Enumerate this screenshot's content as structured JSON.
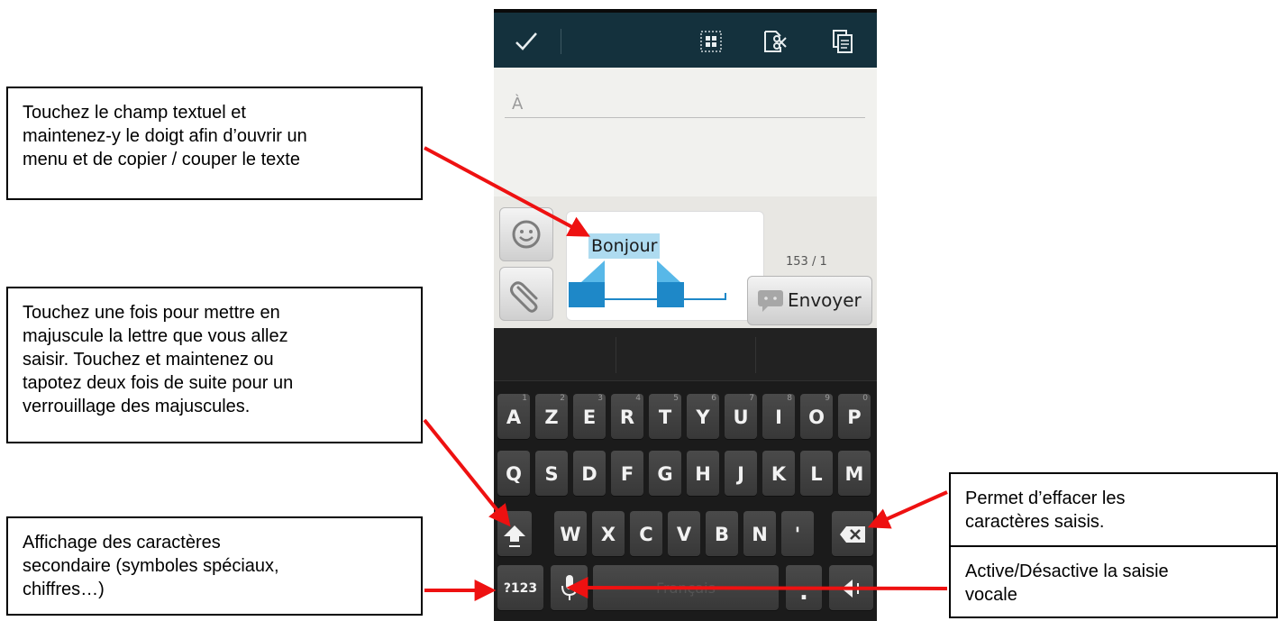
{
  "callouts": {
    "copy_cut": "Touchez le champ textuel et\nmaintenez-y le doigt afin d’ouvrir un\nmenu et de copier / couper le texte",
    "shift": "Touchez une fois pour mettre en\nmajuscule la lettre que vous allez\nsaisir. Touchez et maintenez ou\ntapotez deux fois de suite pour un\nverrouillage des majuscules.",
    "symbols": "Affichage des caractères\nsecondaire (symboles spéciaux,\nchiffres…)",
    "delete": "Permet d’effacer les\ncaractères saisis.",
    "voice": "Active/Désactive la saisie\nvocale"
  },
  "compose": {
    "to_placeholder": "À",
    "message_text": "Bonjour",
    "counter": "153 / 1",
    "send_label": "Envoyer"
  },
  "keyboard": {
    "row1": [
      {
        "key": "A",
        "hint": "1"
      },
      {
        "key": "Z",
        "hint": "2"
      },
      {
        "key": "E",
        "hint": "3"
      },
      {
        "key": "R",
        "hint": "4"
      },
      {
        "key": "T",
        "hint": "5"
      },
      {
        "key": "Y",
        "hint": "6"
      },
      {
        "key": "U",
        "hint": "7"
      },
      {
        "key": "I",
        "hint": "8"
      },
      {
        "key": "O",
        "hint": "9"
      },
      {
        "key": "P",
        "hint": "0"
      }
    ],
    "row2": [
      "Q",
      "S",
      "D",
      "F",
      "G",
      "H",
      "J",
      "K",
      "L",
      "M"
    ],
    "row3": [
      "W",
      "X",
      "C",
      "V",
      "B",
      "N",
      "'"
    ],
    "symbols_key": "?123",
    "space_label": "Français",
    "period_key": "."
  },
  "icons": {
    "actionbar": [
      "check-icon",
      "select-all-icon",
      "cut-icon",
      "copy-icon"
    ],
    "compose": [
      "smiley-icon",
      "paperclip-icon",
      "message-bubble-icon"
    ],
    "keyboard": [
      "shift-icon",
      "backspace-icon",
      "microphone-icon",
      "enter-icon"
    ]
  },
  "colors": {
    "action_bar": "#14313d",
    "selection": "#aedbf0",
    "handles": "#1e88c8",
    "arrow": "#ee1111"
  }
}
